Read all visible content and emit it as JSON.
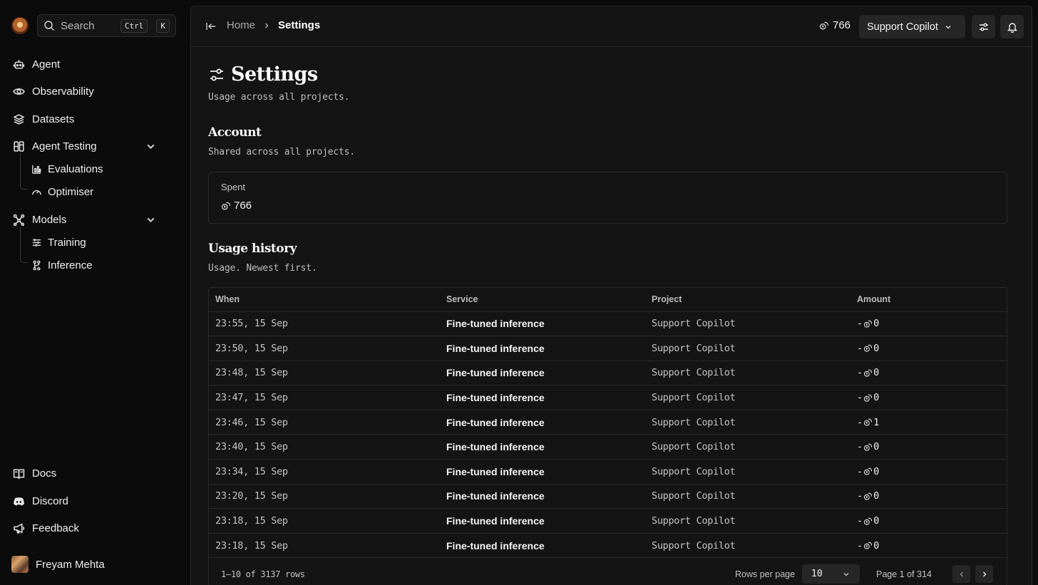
{
  "search": {
    "placeholder": "Search",
    "key1": "Ctrl",
    "key2": "K"
  },
  "sidebar": {
    "items": [
      {
        "label": "Agent",
        "icon": "bot-icon"
      },
      {
        "label": "Observability",
        "icon": "eye-icon"
      },
      {
        "label": "Datasets",
        "icon": "database-icon"
      },
      {
        "label": "Agent Testing",
        "icon": "columns-icon"
      },
      {
        "label": "Models",
        "icon": "network-icon"
      }
    ],
    "agent_testing_children": [
      {
        "label": "Evaluations",
        "icon": "chart-icon"
      },
      {
        "label": "Optimiser",
        "icon": "gauge-icon"
      }
    ],
    "models_children": [
      {
        "label": "Training",
        "icon": "sliders-icon"
      },
      {
        "label": "Inference",
        "icon": "git-icon"
      }
    ],
    "bottom": [
      {
        "label": "Docs",
        "icon": "book-icon"
      },
      {
        "label": "Discord",
        "icon": "discord-icon"
      },
      {
        "label": "Feedback",
        "icon": "megaphone-icon"
      }
    ],
    "user": {
      "name": "Freyam Mehta"
    }
  },
  "topbar": {
    "breadcrumb_home": "Home",
    "breadcrumb_current": "Settings",
    "credits": "766",
    "project": "Support Copilot"
  },
  "page": {
    "title": "Settings",
    "subtitle": "Usage across all projects.",
    "account_title": "Account",
    "account_subtitle": "Shared across all projects.",
    "spent_label": "Spent",
    "spent_value": "766",
    "history_title": "Usage history",
    "history_subtitle": "Usage. Newest first."
  },
  "table": {
    "headers": [
      "When",
      "Service",
      "Project",
      "Amount"
    ],
    "rows": [
      {
        "when": "23:55, 15 Sep",
        "service": "Fine-tuned inference",
        "project": "Support Copilot",
        "amount": "0"
      },
      {
        "when": "23:50, 15 Sep",
        "service": "Fine-tuned inference",
        "project": "Support Copilot",
        "amount": "0"
      },
      {
        "when": "23:48, 15 Sep",
        "service": "Fine-tuned inference",
        "project": "Support Copilot",
        "amount": "0"
      },
      {
        "when": "23:47, 15 Sep",
        "service": "Fine-tuned inference",
        "project": "Support Copilot",
        "amount": "0"
      },
      {
        "when": "23:46, 15 Sep",
        "service": "Fine-tuned inference",
        "project": "Support Copilot",
        "amount": "1"
      },
      {
        "when": "23:40, 15 Sep",
        "service": "Fine-tuned inference",
        "project": "Support Copilot",
        "amount": "0"
      },
      {
        "when": "23:34, 15 Sep",
        "service": "Fine-tuned inference",
        "project": "Support Copilot",
        "amount": "0"
      },
      {
        "when": "23:20, 15 Sep",
        "service": "Fine-tuned inference",
        "project": "Support Copilot",
        "amount": "0"
      },
      {
        "when": "23:18, 15 Sep",
        "service": "Fine-tuned inference",
        "project": "Support Copilot",
        "amount": "0"
      },
      {
        "when": "23:18, 15 Sep",
        "service": "Fine-tuned inference",
        "project": "Support Copilot",
        "amount": "0"
      }
    ],
    "amount_prefix": "-"
  },
  "pager": {
    "rows_text": "1–10 of 3137 rows",
    "rows_per_page_label": "Rows per page",
    "rows_per_page_value": "10",
    "page_text": "Page 1 of 314"
  }
}
